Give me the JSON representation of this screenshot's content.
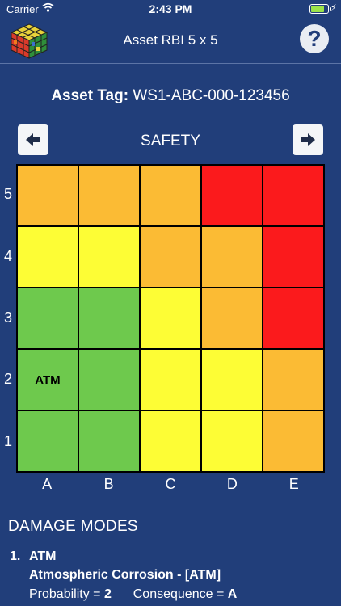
{
  "status_bar": {
    "carrier": "Carrier",
    "time": "2:43 PM"
  },
  "nav": {
    "title": "Asset RBI 5 x 5",
    "help_label": "?"
  },
  "asset": {
    "label": "Asset Tag:",
    "tag": "WS1-ABC-000-123456"
  },
  "category": "SAFETY",
  "matrix": {
    "y_labels": [
      "5",
      "4",
      "3",
      "2",
      "1"
    ],
    "x_labels": [
      "A",
      "B",
      "C",
      "D",
      "E"
    ],
    "cells": [
      [
        "#fbbb34",
        "#fbbb34",
        "#fbbb34",
        "#fb1a1c",
        "#fb1a1c"
      ],
      [
        "#fdfd35",
        "#fdfd35",
        "#fbbb34",
        "#fbbb34",
        "#fb1a1c"
      ],
      [
        "#6ec94d",
        "#6ec94d",
        "#fdfd35",
        "#fbbb34",
        "#fb1a1c"
      ],
      [
        "#6ec94d",
        "#6ec94d",
        "#fdfd35",
        "#fdfd35",
        "#fbbb34"
      ],
      [
        "#6ec94d",
        "#6ec94d",
        "#fdfd35",
        "#fdfd35",
        "#fbbb34"
      ]
    ],
    "markers": [
      {
        "row": "2",
        "col": "A",
        "text": "ATM"
      }
    ]
  },
  "damage_modes": {
    "title": "DAMAGE MODES",
    "items": [
      {
        "number": "1.",
        "code": "ATM",
        "name": "Atmospheric Corrosion - [ATM]",
        "probability_label": "Probability = ",
        "probability": "2",
        "consequence_label": "Consequence = ",
        "consequence": "A"
      }
    ]
  }
}
